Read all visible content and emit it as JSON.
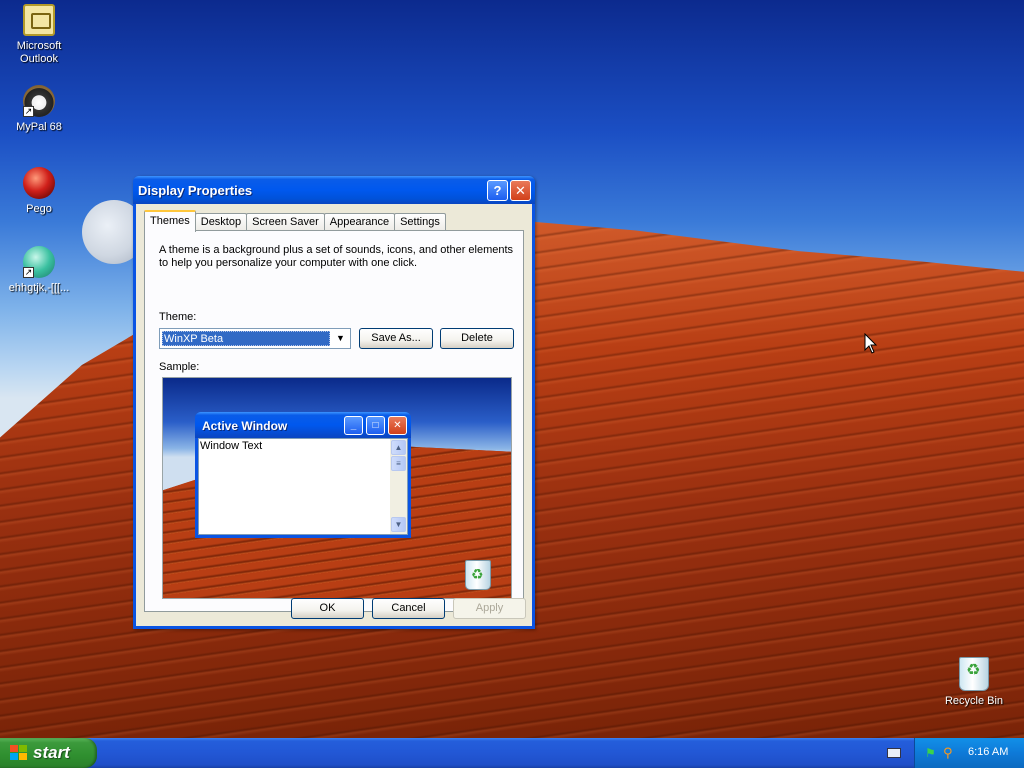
{
  "desktop": {
    "icons": [
      {
        "label_line1": "Microsoft",
        "label_line2": "Outlook"
      },
      {
        "label_line1": "MyPal 68"
      },
      {
        "label_line1": "Pego"
      },
      {
        "label_line1": "ehhgtjk,-[[[..."
      },
      {
        "label_line1": "Recycle Bin"
      }
    ]
  },
  "dialog": {
    "title": "Display Properties",
    "help_glyph": "?",
    "close_glyph": "✕",
    "tabs": [
      {
        "label": "Themes",
        "active": true
      },
      {
        "label": "Desktop"
      },
      {
        "label": "Screen Saver"
      },
      {
        "label": "Appearance"
      },
      {
        "label": "Settings"
      }
    ],
    "description": "A theme is a background plus a set of sounds, icons, and other elements to help you personalize your computer with one click.",
    "theme_label": "Theme:",
    "theme_value": "WinXP Beta",
    "save_as_label": "Save As...",
    "delete_label": "Delete",
    "sample_label": "Sample:",
    "sample": {
      "window_title": "Active Window",
      "window_text": "Window Text"
    },
    "ok_label": "OK",
    "cancel_label": "Cancel",
    "apply_label": "Apply"
  },
  "taskbar": {
    "start_label": "start",
    "clock": "6:16 AM"
  },
  "colors": {
    "titlebar_blue": "#0058ee",
    "start_green": "#3c9a3c",
    "selection": "#316ac5",
    "tab_highlight": "#ffc73c"
  }
}
